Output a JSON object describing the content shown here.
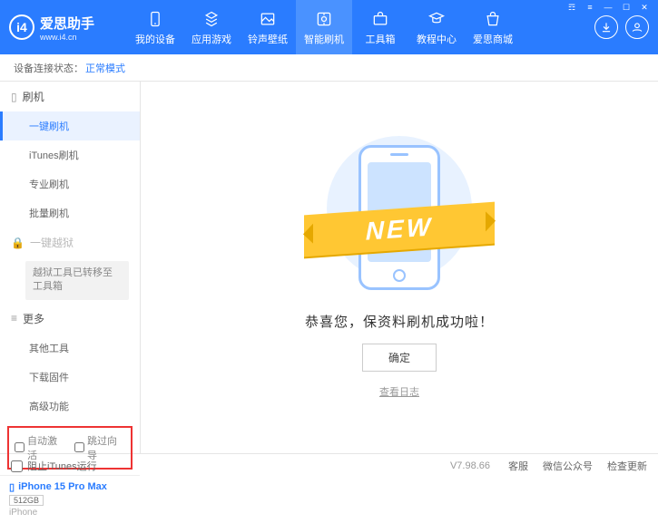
{
  "app": {
    "title": "爱思助手",
    "url": "www.i4.cn"
  },
  "nav": [
    {
      "label": "我的设备"
    },
    {
      "label": "应用游戏"
    },
    {
      "label": "铃声壁纸"
    },
    {
      "label": "智能刷机"
    },
    {
      "label": "工具箱"
    },
    {
      "label": "教程中心"
    },
    {
      "label": "爱思商城"
    }
  ],
  "status": {
    "label": "设备连接状态：",
    "value": "正常模式"
  },
  "sidebar": {
    "flash": {
      "header": "刷机",
      "items": [
        "一键刷机",
        "iTunes刷机",
        "专业刷机",
        "批量刷机"
      ]
    },
    "jailbreak": {
      "header": "一键越狱",
      "note": "越狱工具已转移至工具箱"
    },
    "more": {
      "header": "更多",
      "items": [
        "其他工具",
        "下载固件",
        "高级功能"
      ]
    },
    "checkboxes": {
      "auto_activate": "自动激活",
      "skip_guide": "跳过向导"
    }
  },
  "device": {
    "name": "iPhone 15 Pro Max",
    "storage": "512GB",
    "type": "iPhone"
  },
  "content": {
    "ribbon": "NEW",
    "success": "恭喜您，保资料刷机成功啦！",
    "ok": "确定",
    "log": "查看日志"
  },
  "footer": {
    "block_itunes": "阻止iTunes运行",
    "version": "V7.98.66",
    "links": [
      "客服",
      "微信公众号",
      "检查更新"
    ]
  }
}
